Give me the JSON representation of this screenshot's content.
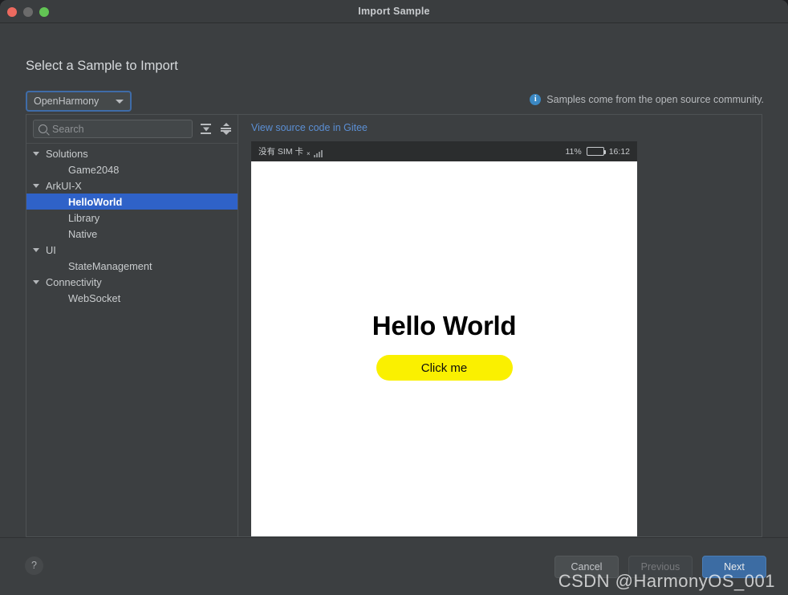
{
  "window": {
    "title": "Import Sample",
    "traffic_lights": [
      "close-red",
      "minimize-gray",
      "zoom-green"
    ]
  },
  "heading": "Select a Sample to Import",
  "source_select": {
    "value": "OpenHarmony",
    "caret": "chevron-down-icon"
  },
  "info_note": {
    "icon": "info-icon",
    "text": "Samples come from the open source community."
  },
  "tree_panel": {
    "search": {
      "value": "",
      "placeholder": "Search",
      "icon": "search-icon"
    },
    "toolbar": {
      "expand_all_label": "Expand All",
      "collapse_all_label": "Collapse All"
    },
    "items": [
      {
        "label": "Solutions",
        "type": "group",
        "expanded": true,
        "selected": false
      },
      {
        "label": "Game2048",
        "type": "child",
        "expanded": false,
        "selected": false
      },
      {
        "label": "ArkUI-X",
        "type": "group",
        "expanded": true,
        "selected": false
      },
      {
        "label": "HelloWorld",
        "type": "child",
        "expanded": false,
        "selected": true
      },
      {
        "label": "Library",
        "type": "child",
        "expanded": false,
        "selected": false
      },
      {
        "label": "Native",
        "type": "child",
        "expanded": false,
        "selected": false
      },
      {
        "label": "UI",
        "type": "group",
        "expanded": true,
        "selected": false
      },
      {
        "label": "StateManagement",
        "type": "child",
        "expanded": false,
        "selected": false
      },
      {
        "label": "Connectivity",
        "type": "group",
        "expanded": true,
        "selected": false
      },
      {
        "label": "WebSocket",
        "type": "child",
        "expanded": false,
        "selected": false
      }
    ]
  },
  "preview": {
    "gitee_link": "View source code in Gitee",
    "status_bar": {
      "carrier": "没有 SIM 卡",
      "signal_state": "no-signal",
      "battery_percent": "11%",
      "battery_level": 11,
      "time": "16:12"
    },
    "app": {
      "title": "Hello World",
      "button_label": "Click me"
    }
  },
  "footer": {
    "help_label": "?",
    "cancel_label": "Cancel",
    "previous_label": "Previous",
    "next_label": "Next"
  },
  "watermark": "CSDN @HarmonyOS_001",
  "colors": {
    "window_bg": "#3c3f41",
    "selection_blue": "#2f62c8",
    "link_blue": "#5b8fd4",
    "primary_button": "#3c6ca3",
    "accent_yellow": "#faf000",
    "battery_green": "#3ddc47",
    "focus_border": "#3f6ca8"
  }
}
